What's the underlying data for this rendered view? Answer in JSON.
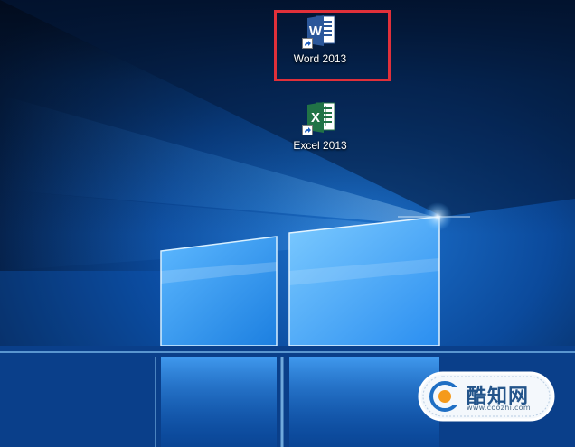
{
  "desktop": {
    "icons": [
      {
        "label": "Word 2013",
        "app_letter": "W",
        "icon": "word-icon",
        "color": "#2b579a"
      },
      {
        "label": "Excel 2013",
        "app_letter": "X",
        "icon": "excel-icon",
        "color": "#217346"
      }
    ],
    "selection_highlight_color": "#e0303a",
    "wallpaper_colors": {
      "light": "#6fc3ff",
      "dark": "#03112a"
    }
  },
  "watermark": {
    "name": "酷知网",
    "url": "www.coozhi.com"
  }
}
